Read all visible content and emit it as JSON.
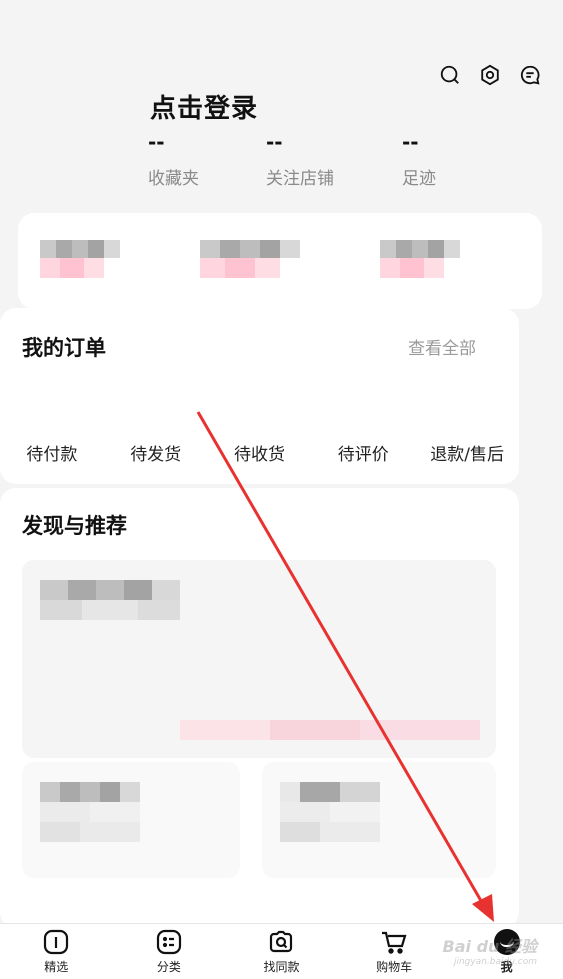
{
  "header": {
    "login_label": "点击登录",
    "icons": [
      "search-icon",
      "settings-icon",
      "message-icon"
    ]
  },
  "stats": [
    {
      "value": "--",
      "label": "收藏夹"
    },
    {
      "value": "--",
      "label": "关注店铺"
    },
    {
      "value": "--",
      "label": "足迹"
    }
  ],
  "orders": {
    "title": "我的订单",
    "view_all": "查看全部",
    "tabs": [
      "待付款",
      "待发货",
      "待收货",
      "待评价",
      "退款/售后"
    ]
  },
  "discover": {
    "title": "发现与推荐"
  },
  "bottom_nav": {
    "items": [
      {
        "label": "精选",
        "icon": "featured-icon"
      },
      {
        "label": "分类",
        "icon": "category-icon"
      },
      {
        "label": "找同款",
        "icon": "camera-search-icon"
      },
      {
        "label": "购物车",
        "icon": "cart-icon"
      },
      {
        "label": "我",
        "icon": "avatar-icon"
      }
    ],
    "active_index": 4
  },
  "watermark": {
    "text": "Bai du 经验",
    "sub": "jingyan.baidu.com"
  },
  "colors": {
    "annotation_arrow": "#e8322f",
    "text_muted": "#8a8a8a"
  }
}
